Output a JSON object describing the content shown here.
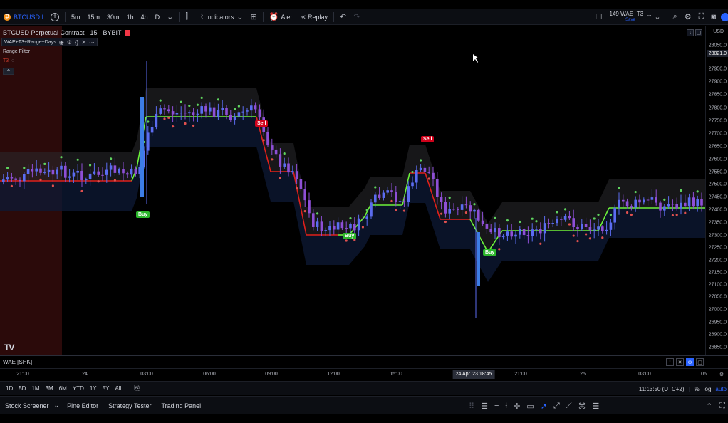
{
  "toolbar": {
    "symbol": "BTCUSD.I",
    "intervals": [
      "5m",
      "15m",
      "30m",
      "1h",
      "4h",
      "D"
    ],
    "active_interval": "15m",
    "indicators_label": "Indicators",
    "alert_label": "Alert",
    "replay_label": "Replay",
    "layout_name": "149 WAE+T3+...",
    "layout_status": "Save"
  },
  "chart": {
    "title": "BTCUSD Perpetual Contract · 15 · BYBIT",
    "indicator_name": "WAE+T3+Range+Days",
    "range_filter_label": "Range Filter",
    "range_filter_sub": "T3",
    "signals": {
      "buy": "Buy",
      "sell": "Sell"
    },
    "currency": "USD",
    "current_price": "28021.0",
    "price_ticks": [
      "28050.0",
      "27950.0",
      "27900.0",
      "27850.0",
      "27800.0",
      "27750.0",
      "27700.0",
      "27650.0",
      "27600.0",
      "27550.0",
      "27500.0",
      "27450.0",
      "27400.0",
      "27350.0",
      "27300.0",
      "27250.0",
      "27200.0",
      "27150.0",
      "27100.0",
      "27050.0",
      "27000.0",
      "26950.0",
      "26900.0",
      "26850.0"
    ]
  },
  "wae_pane": {
    "label": "WAE [SHK]"
  },
  "time_axis": {
    "ticks": [
      "21:00",
      "24",
      "03:00",
      "06:00",
      "09:00",
      "12:00",
      "15:00",
      "21:00",
      "25",
      "03:00",
      "06"
    ],
    "cursor": "24 Apr '23   18:45"
  },
  "range_bar": {
    "ranges": [
      "1D",
      "5D",
      "1M",
      "3M",
      "6M",
      "YTD",
      "1Y",
      "5Y",
      "All"
    ],
    "clock": "11:13:50 (UTC+2)",
    "percent": "%",
    "log": "log",
    "auto": "auto"
  },
  "bottom_tabs": [
    "Stock Screener",
    "Pine Editor",
    "Strategy Tester",
    "Trading Panel"
  ],
  "colors": {
    "up": "#5b6cf0",
    "down": "#8e4fd6",
    "buy": "#2bb52b",
    "sell": "#d0021b",
    "filter_up": "#6df23a",
    "filter_down": "#e0201b"
  }
}
